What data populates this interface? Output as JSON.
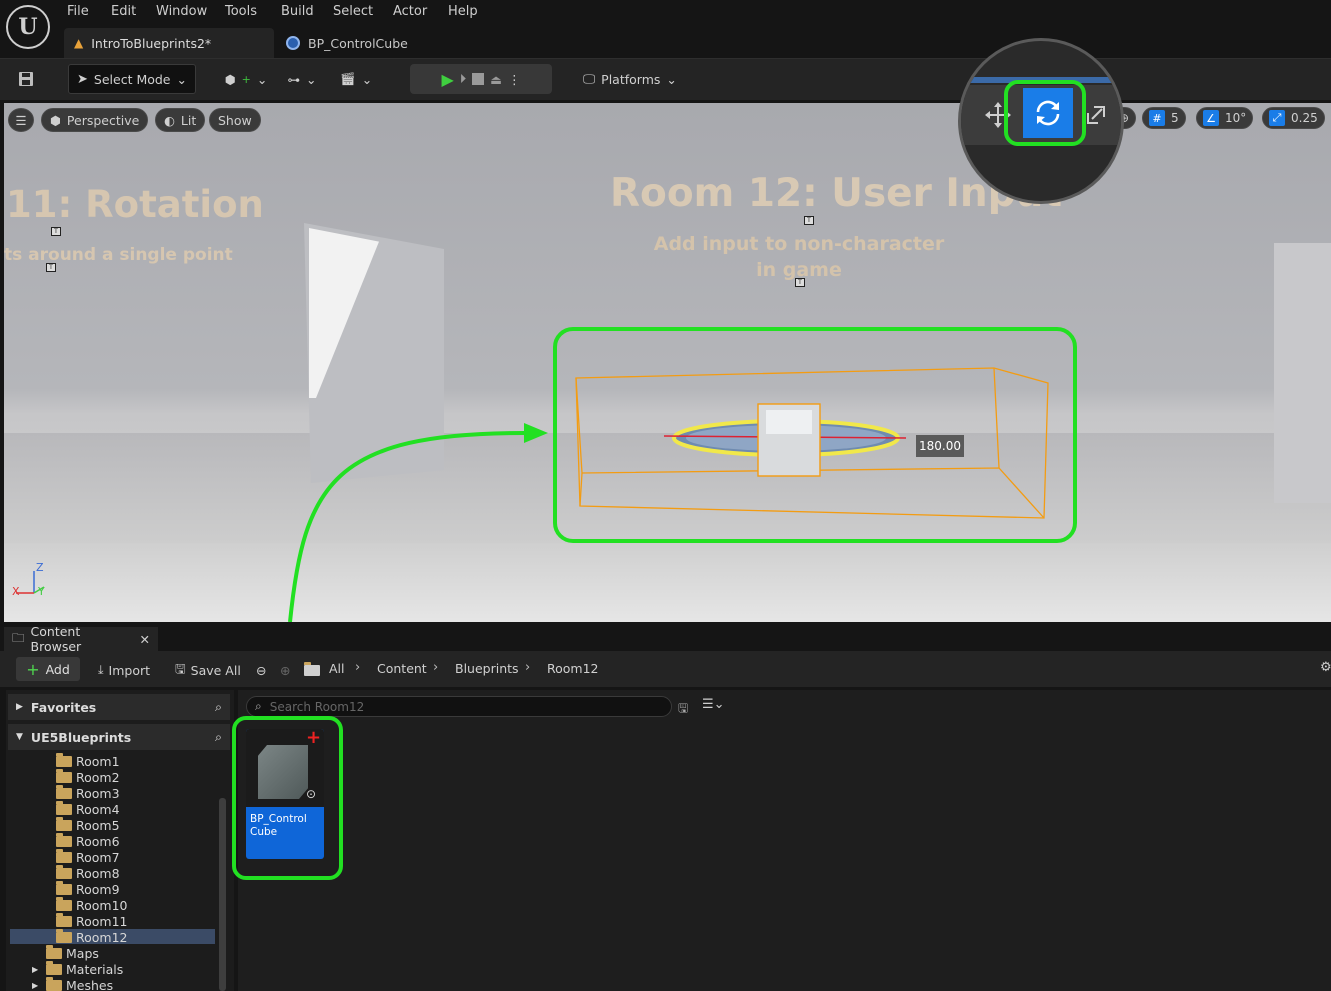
{
  "menu": [
    "File",
    "Edit",
    "Window",
    "Tools",
    "Build",
    "Select",
    "Actor",
    "Help"
  ],
  "tabs": {
    "level": "IntroToBlueprints2*",
    "blueprint": "BP_ControlCube"
  },
  "toolbar": {
    "select_mode": "Select Mode",
    "platforms": "Platforms"
  },
  "viewport": {
    "perspective": "Perspective",
    "lit": "Lit",
    "show": "Show",
    "grid_snap": "5",
    "rotation_snap": "10°",
    "scale_snap": "0.25",
    "room12_title": "Room 12: User Input",
    "room12_subtitle": "Add input to non-character in game",
    "room11_title": "11: Rotation",
    "room11_subtitle": "ts around a single point",
    "rotation_value": "180.00",
    "axis_z": "Z",
    "axis_x": "X",
    "axis_y": "Y"
  },
  "content_browser": {
    "tab_label": "Content Browser",
    "add": "Add",
    "import": "Import",
    "save_all": "Save All",
    "breadcrumbs": [
      "All",
      "Content",
      "Blueprints",
      "Room12"
    ],
    "search_placeholder": "Search Room12",
    "favorites": "Favorites",
    "project": "UE5Blueprints",
    "folders": [
      "Room1",
      "Room2",
      "Room3",
      "Room4",
      "Room5",
      "Room6",
      "Room7",
      "Room8",
      "Room9",
      "Room10",
      "Room11",
      "Room12"
    ],
    "other_folders": [
      "Maps",
      "Materials",
      "Meshes"
    ],
    "asset_name": "BP_Control Cube"
  },
  "colors": {
    "highlight": "#22e022",
    "accent": "#1a7de8",
    "selection_box": "#f39c12"
  }
}
